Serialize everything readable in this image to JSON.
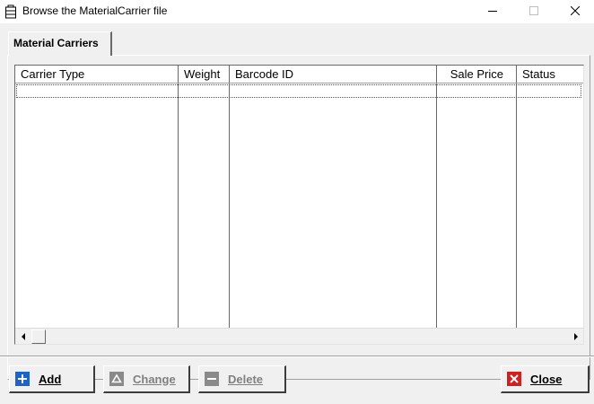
{
  "window": {
    "title": "Browse the MaterialCarrier file",
    "app_icon": "database-icon",
    "controls": {
      "minimize_icon": "minimize-icon",
      "maximize_icon": "maximize-icon",
      "close_icon": "close-icon"
    }
  },
  "tabs": [
    {
      "label": "Material Carriers",
      "selected": true
    }
  ],
  "table": {
    "columns": [
      "Carrier Type",
      "Weight",
      "Barcode ID",
      "Sale Price",
      "Status"
    ],
    "rows": []
  },
  "buttons": {
    "add": {
      "label": "Add",
      "icon": "plus-icon",
      "enabled": true,
      "color": "#1e64c8"
    },
    "change": {
      "label": "Change",
      "icon": "edit-icon",
      "enabled": false
    },
    "delete": {
      "label": "Delete",
      "icon": "minus-icon",
      "enabled": false
    },
    "close": {
      "label": "Close",
      "icon": "close-icon",
      "enabled": true,
      "color": "#d02020"
    }
  }
}
